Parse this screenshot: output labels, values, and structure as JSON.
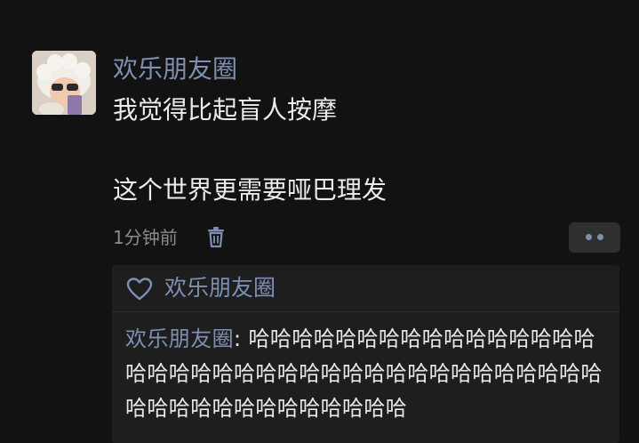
{
  "post": {
    "author": "欢乐朋友圈",
    "text_line1": "我觉得比起盲人按摩",
    "text_line2": "这个世界更需要哑巴理发",
    "time": "1分钟前",
    "delete_icon": "trash-icon",
    "more_icon": "more-dots-icon"
  },
  "likes": {
    "icon": "heart-icon",
    "names": "欢乐朋友圈"
  },
  "comments": [
    {
      "author": "欢乐朋友圈",
      "separator": ": ",
      "text": "哈哈哈哈哈哈哈哈哈哈哈哈哈哈哈哈哈哈哈哈哈哈哈哈哈哈哈哈哈哈哈哈哈哈哈哈哈哈哈哈哈哈哈哈哈哈哈哈哈哈哈"
    }
  ],
  "colors": {
    "background": "#121212",
    "name_link": "#7f8fb3",
    "text": "#ececec",
    "muted": "#8b8b8b",
    "panel": "#1e1e1e"
  }
}
